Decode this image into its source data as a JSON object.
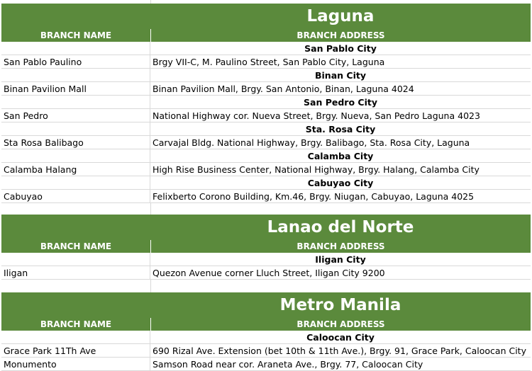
{
  "headers": {
    "name": "BRANCH NAME",
    "address": "BRANCH ADDRESS"
  },
  "regions": [
    {
      "title": "Laguna",
      "rows": [
        {
          "type": "city",
          "text": "San Pablo City"
        },
        {
          "type": "branch",
          "name": "San Pablo Paulino",
          "address": "Brgy VII-C, M. Paulino Street, San Pablo City, Laguna"
        },
        {
          "type": "city",
          "text": "Binan City"
        },
        {
          "type": "branch",
          "name": "Binan Pavilion Mall",
          "address": "Binan Pavilion Mall, Brgy. San Antonio, Binan, Laguna 4024"
        },
        {
          "type": "city",
          "text": "San Pedro City"
        },
        {
          "type": "branch",
          "name": "San Pedro",
          "address": "National Highway cor. Nueva Street, Brgy. Nueva, San Pedro Laguna 4023"
        },
        {
          "type": "city",
          "text": "Sta. Rosa City"
        },
        {
          "type": "branch",
          "name": "Sta Rosa Balibago",
          "address": "Carvajal Bldg. National Highway, Brgy. Balibago, Sta. Rosa City, Laguna"
        },
        {
          "type": "city",
          "text": "Calamba City"
        },
        {
          "type": "branch",
          "name": "Calamba Halang",
          "address": "High Rise Business Center, National Highway, Brgy. Halang, Calamba City"
        },
        {
          "type": "city",
          "text": "Cabuyao City"
        },
        {
          "type": "branch",
          "name": "Cabuyao",
          "address": "Felixberto Corono Building, Km.46, Brgy. Niugan, Cabuyao, Laguna 4025"
        },
        {
          "type": "empty"
        }
      ]
    },
    {
      "title": "Lanao del Norte",
      "rows": [
        {
          "type": "city",
          "text": "Iligan City"
        },
        {
          "type": "branch",
          "name": "Iligan",
          "address": "Quezon Avenue corner Lluch Street,  Iligan City 9200"
        },
        {
          "type": "empty"
        }
      ]
    },
    {
      "title": "Metro Manila",
      "rows": [
        {
          "type": "city",
          "text": "Caloocan City"
        },
        {
          "type": "branch",
          "name": "Grace Park 11Th Ave",
          "address": "690 Rizal Ave. Extension (bet 10th & 11th Ave.), Brgy. 91, Grace Park, Caloocan City"
        },
        {
          "type": "branch",
          "name": "Monumento",
          "address": "Samson Road near cor. Araneta Ave., Brgy. 77, Caloocan City"
        }
      ]
    }
  ]
}
